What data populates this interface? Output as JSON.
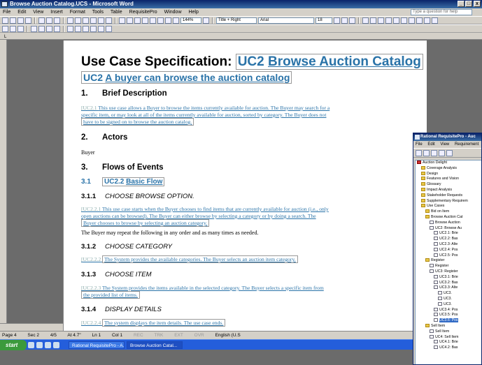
{
  "window": {
    "title": "Browse Auction Catalog.UCS - Microsoft Word",
    "controls": [
      "_",
      "□",
      "x"
    ]
  },
  "menu": [
    "File",
    "Edit",
    "View",
    "Insert",
    "Format",
    "Tools",
    "Table",
    "RequisitePro",
    "Window",
    "Help"
  ],
  "help_placeholder": "Type a question for help",
  "toolbar": {
    "zoom": "144%",
    "style": "Title + Right",
    "font": "Arial",
    "size": "18"
  },
  "ruler": {
    "left_marker": "L"
  },
  "doc": {
    "title_prefix": "Use Case Specification:",
    "title_id": "UC2",
    "title_name": "Browse Auction Catalog",
    "subtitle_id": "UC2",
    "subtitle_text": "A buyer can browse the auction catalog",
    "sections": [
      {
        "num": "1.",
        "label": "Brief Description"
      },
      {
        "num": "2.",
        "label": "Actors"
      },
      {
        "num": "3.",
        "label": "Flows of Events"
      }
    ],
    "brief": {
      "tag": "[UC2.1",
      "line1": "This use case allows a Buyer to browse the items currently available for auction.  The Buyer may search for a",
      "line2": "specific item, or may look at all of the items currently available for auction, sorted by category.  The Buyer does not",
      "line3": "have to be signed on to browse the auction catalog."
    },
    "actor": "Buyer",
    "basic_flow": {
      "num": "3.1",
      "id": "UC2.2",
      "label": "Basic Flow"
    },
    "steps": [
      {
        "num": "3.1.1",
        "label": "CHOOSE BROWSE OPTION."
      },
      {
        "num": "3.1.2",
        "label": "CHOOSE CATEGORY"
      },
      {
        "num": "3.1.3",
        "label": "CHOOSE ITEM"
      },
      {
        "num": "3.1.4",
        "label": "DISPLAY DETAILS"
      }
    ],
    "step1": {
      "tag": "[UC2.2.1",
      "line1": "This use case starts when the Buyer chooses to find items that are currently available for auction (i.e., only",
      "line2": "open auctions can be browsed).  The Buyer can either browse by selecting a category or by doing a search.  The",
      "line3": "Buyer chooses to browse by selecting an auction category."
    },
    "repeat_note": "The Buyer may repeat the following in any order and as many times as needed.",
    "step2": {
      "tag": "[UC2.2.2",
      "line1": "The System provides the available categories.  The Buyer selects an auction item category."
    },
    "step3": {
      "tag": "[UC2.2.3",
      "line1": "The System provides the items available in the selected category.   The Buyer selects a specific item from",
      "line2": "the provided list of items."
    },
    "step4": {
      "tag": "[UC2.2.4",
      "line1": "The system displays the item details.  The use case ends."
    }
  },
  "status": {
    "page": "Page 4",
    "sec": "Sec 2",
    "pages": "4/5",
    "at": "At 4.7\"",
    "ln": "Ln 1",
    "col": "Col 1",
    "rec": "REC",
    "trk": "TRK",
    "ext": "EXT",
    "ovr": "OVR",
    "lang": "English (U.S"
  },
  "taskbar": {
    "start": "start",
    "items": [
      "Rational RequisitePro - A...",
      "Browse Auction Catal..."
    ]
  },
  "reqpro": {
    "title": "Rational RequisitePro - Auc",
    "menu": [
      "File",
      "Edit",
      "View",
      "Requirement"
    ],
    "tree": [
      {
        "label": "Auction Delight",
        "level": 0,
        "kind": "root"
      },
      {
        "label": "Coverage Analysis",
        "level": 1,
        "kind": "folder"
      },
      {
        "label": "Design",
        "level": 1,
        "kind": "folder"
      },
      {
        "label": "Features and Vision",
        "level": 1,
        "kind": "folder"
      },
      {
        "label": "Glossary",
        "level": 1,
        "kind": "folder"
      },
      {
        "label": "Impact Analysis",
        "level": 1,
        "kind": "folder"
      },
      {
        "label": "Stakeholder Requests",
        "level": 1,
        "kind": "folder"
      },
      {
        "label": "Supplementary Requirem",
        "level": 1,
        "kind": "folder"
      },
      {
        "label": "Use Cases",
        "level": 1,
        "kind": "folder"
      },
      {
        "label": "Bid on Item",
        "level": 2,
        "kind": "folder"
      },
      {
        "label": "Browse Auction Cat",
        "level": 2,
        "kind": "folder"
      },
      {
        "label": "Browse Auction",
        "level": 3,
        "kind": "doc"
      },
      {
        "label": "UC2: Browse Au",
        "level": 3,
        "kind": "doc"
      },
      {
        "label": "UC2.1: Brie",
        "level": 4,
        "kind": "doc"
      },
      {
        "label": "UC2.2: Bas",
        "level": 4,
        "kind": "doc"
      },
      {
        "label": "UC2.3: Alte",
        "level": 4,
        "kind": "doc"
      },
      {
        "label": "UC2.4: Pos",
        "level": 4,
        "kind": "doc"
      },
      {
        "label": "UC2.5: Pos",
        "level": 4,
        "kind": "doc"
      },
      {
        "label": "Register",
        "level": 2,
        "kind": "folder"
      },
      {
        "label": "Register",
        "level": 3,
        "kind": "doc"
      },
      {
        "label": "UC3: Register",
        "level": 3,
        "kind": "doc"
      },
      {
        "label": "UC3.1: Brie",
        "level": 4,
        "kind": "doc"
      },
      {
        "label": "UC3.2: Bas",
        "level": 4,
        "kind": "doc"
      },
      {
        "label": "UC3.3: Alte",
        "level": 4,
        "kind": "doc"
      },
      {
        "label": "UC3.",
        "level": 5,
        "kind": "doc"
      },
      {
        "label": "UC3.",
        "level": 5,
        "kind": "doc"
      },
      {
        "label": "UC3.",
        "level": 5,
        "kind": "doc"
      },
      {
        "label": "UC3.4: Pos",
        "level": 4,
        "kind": "doc"
      },
      {
        "label": "UC3.5: Pos",
        "level": 4,
        "kind": "doc"
      },
      {
        "label": "UC3.6: Pos",
        "level": 4,
        "kind": "doc",
        "selected": true
      },
      {
        "label": "Sell Item",
        "level": 2,
        "kind": "folder"
      },
      {
        "label": "Sell Item",
        "level": 3,
        "kind": "doc"
      },
      {
        "label": "UC4: Sell Item",
        "level": 3,
        "kind": "doc"
      },
      {
        "label": "UC4.1: Brie",
        "level": 4,
        "kind": "doc"
      },
      {
        "label": "UC4.2: Bas",
        "level": 4,
        "kind": "doc"
      }
    ]
  }
}
